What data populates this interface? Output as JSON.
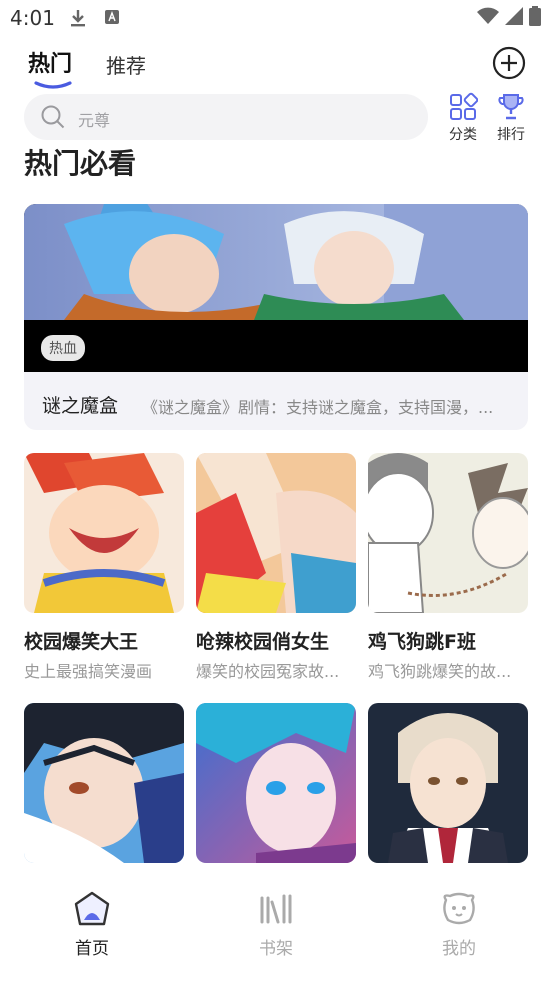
{
  "status": {
    "time": "4:01"
  },
  "tabs": {
    "hot": "热门",
    "recommend": "推荐"
  },
  "search": {
    "placeholder": "元尊"
  },
  "quick": {
    "category": "分类",
    "ranking": "排行"
  },
  "section": {
    "title": "热门必看"
  },
  "featured": {
    "tag": "热血",
    "name": "谜之魔盒",
    "desc": "《谜之魔盒》剧情：支持谜之魔盒，支持国漫，..."
  },
  "comics": [
    {
      "title": "校园爆笑大王",
      "desc": "史上最强搞笑漫画"
    },
    {
      "title": "呛辣校园俏女生",
      "desc": "爆笑的校园冤家故..."
    },
    {
      "title": "鸡飞狗跳F班",
      "desc": "鸡飞狗跳爆笑的故..."
    },
    {
      "title": "",
      "desc": ""
    },
    {
      "title": "",
      "desc": ""
    },
    {
      "title": "",
      "desc": ""
    }
  ],
  "nav": {
    "home": "首页",
    "shelf": "书架",
    "me": "我的"
  },
  "colors": {
    "accent": "#4a5be0",
    "active_icon": "#5a6ae8",
    "inactive": "#aaaaaa"
  }
}
